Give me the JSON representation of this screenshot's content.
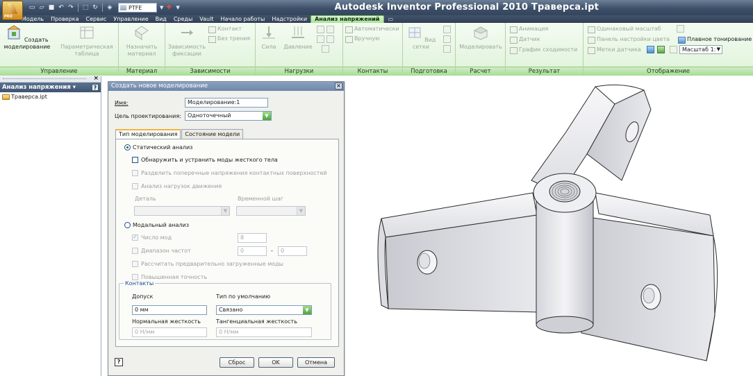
{
  "window": {
    "title": "Autodesk Inventor Professional 2010  Траверса.ipt",
    "app_badge": "PRO"
  },
  "quick_access": {
    "material": "PTFE"
  },
  "ribbon_tabs": [
    {
      "label": "Модель"
    },
    {
      "label": "Проверка"
    },
    {
      "label": "Сервис"
    },
    {
      "label": "Управление"
    },
    {
      "label": "Вид"
    },
    {
      "label": "Среды"
    },
    {
      "label": "Vault"
    },
    {
      "label": "Начало работы"
    },
    {
      "label": "Надстройки"
    },
    {
      "label": "Анализ напряжений"
    }
  ],
  "ribbon": {
    "manage": {
      "title": "Управление",
      "create_sim": "Создать моделирование",
      "param_table": "Параметрическая таблица"
    },
    "material": {
      "title": "Материал",
      "assign": "Назначить материал"
    },
    "constraints": {
      "title": "Зависимости",
      "fixed": "Зависимость фиксации",
      "contact": "Контакт",
      "frictionless": "Без трения"
    },
    "loads": {
      "title": "Нагрузки",
      "force": "Сила",
      "pressure": "Давление"
    },
    "contacts": {
      "title": "Контакты",
      "automatic": "Автоматически",
      "manual": "Вручную"
    },
    "prepare": {
      "title": "Подготовка",
      "mesh_view": "Вид сетки"
    },
    "solve": {
      "title": "Расчет",
      "simulate": "Моделировать"
    },
    "result": {
      "title": "Результат",
      "animation": "Анимация",
      "probe": "Датчик",
      "convergence": "График сходимости"
    },
    "display": {
      "title": "Отображение",
      "same_scale": "Одинаковый масштаб",
      "color_bar": "Панель настройки цвета",
      "smooth_shading": "Плавное тонирование",
      "probe_labels": "Метки датчика",
      "scale": "Масштаб 1:"
    }
  },
  "browser": {
    "title": "Анализ напряжения",
    "items": [
      {
        "label": "Траверса.ipt"
      }
    ]
  },
  "dialog": {
    "title": "Создать новое моделирование",
    "name_label": "Имя:",
    "name_value": "Моделирование:1",
    "goal_label": "Цель проектирования:",
    "goal_value": "Одноточечный",
    "tabs": [
      {
        "label": "Тип моделирования"
      },
      {
        "label": "Состояние модели"
      }
    ],
    "static_analysis": "Статический анализ",
    "rigid_modes": "Обнаружить и устранить моды жесткого тела",
    "separate_stresses": "Разделить поперечные напряжения контактных поверхностей",
    "motion_loads": "Анализ нагрузок движения",
    "part_label": "Деталь",
    "time_step_label": "Временной шаг",
    "modal_analysis": "Модальный анализ",
    "num_modes": "Число мод",
    "num_modes_value": "8",
    "freq_range": "Диапазон частот",
    "freq_from": "0",
    "freq_sep": "-",
    "freq_to": "0",
    "preloaded": "Рассчитать предварительно загруженные моды",
    "high_precision": "Повышенная точность",
    "contacts_group": "Контакты",
    "tolerance_label": "Допуск",
    "tolerance_value": "0 мм",
    "default_type_label": "Тип по умолчанию",
    "default_type_value": "Связано",
    "normal_stiffness_label": "Нормальная жесткость",
    "normal_stiffness_value": "0 Н/мм",
    "tangential_stiffness_label": "Тангенциальная жесткость",
    "tangential_stiffness_value": "0 Н/мм",
    "reset_button": "Сброс",
    "ok_button": "OK",
    "cancel_button": "Отмена"
  },
  "colors": {
    "active_tab": "#a9e29a",
    "ribbon_bg": "#e6f6e2",
    "title_bar": "#3e5069",
    "dialog_title": "#7a91b2"
  }
}
